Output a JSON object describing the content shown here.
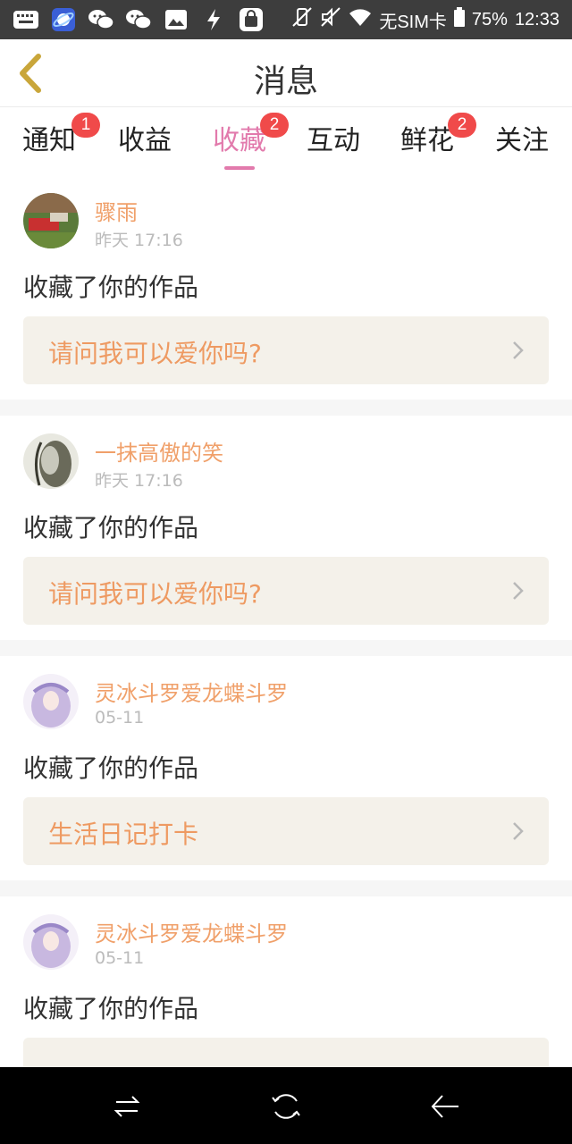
{
  "status_bar": {
    "icons_left": [
      "keyboard-icon",
      "browser-icon",
      "wechat-icon",
      "wechat-icon",
      "image-icon",
      "flash-icon",
      "bag-icon"
    ],
    "icons_right": [
      "vibrate-off-icon",
      "mute-icon",
      "wifi-icon"
    ],
    "sim": "无SIM卡",
    "battery": "75%",
    "time": "12:33"
  },
  "header": {
    "title": "消息"
  },
  "tabs": [
    {
      "label": "通知",
      "badge": "1"
    },
    {
      "label": "收益",
      "badge": ""
    },
    {
      "label": "收藏",
      "badge": "2",
      "active": true
    },
    {
      "label": "互动",
      "badge": ""
    },
    {
      "label": "鲜花",
      "badge": "2"
    },
    {
      "label": "关注",
      "badge": ""
    }
  ],
  "feed": [
    {
      "name": "骤雨",
      "time": "昨天 17:16",
      "action": "收藏了你的作品",
      "work": "请问我可以爱你吗?"
    },
    {
      "name": "一抹高傲的笑",
      "time": "昨天 17:16",
      "action": "收藏了你的作品",
      "work": "请问我可以爱你吗?"
    },
    {
      "name": "灵冰斗罗爱龙蝶斗罗",
      "time": "05-11",
      "action": "收藏了你的作品",
      "work": "生活日记打卡"
    },
    {
      "name": "灵冰斗罗爱龙蝶斗罗",
      "time": "05-11",
      "action": "收藏了你的作品",
      "work": ""
    }
  ],
  "colors": {
    "accent": "#e27aac",
    "name": "#f0a06a",
    "work_text": "#ee9a62",
    "badge": "#f04a4a"
  },
  "nav_bar": {
    "icons": [
      "recent-apps-icon",
      "home-icon",
      "back-nav-icon"
    ]
  }
}
